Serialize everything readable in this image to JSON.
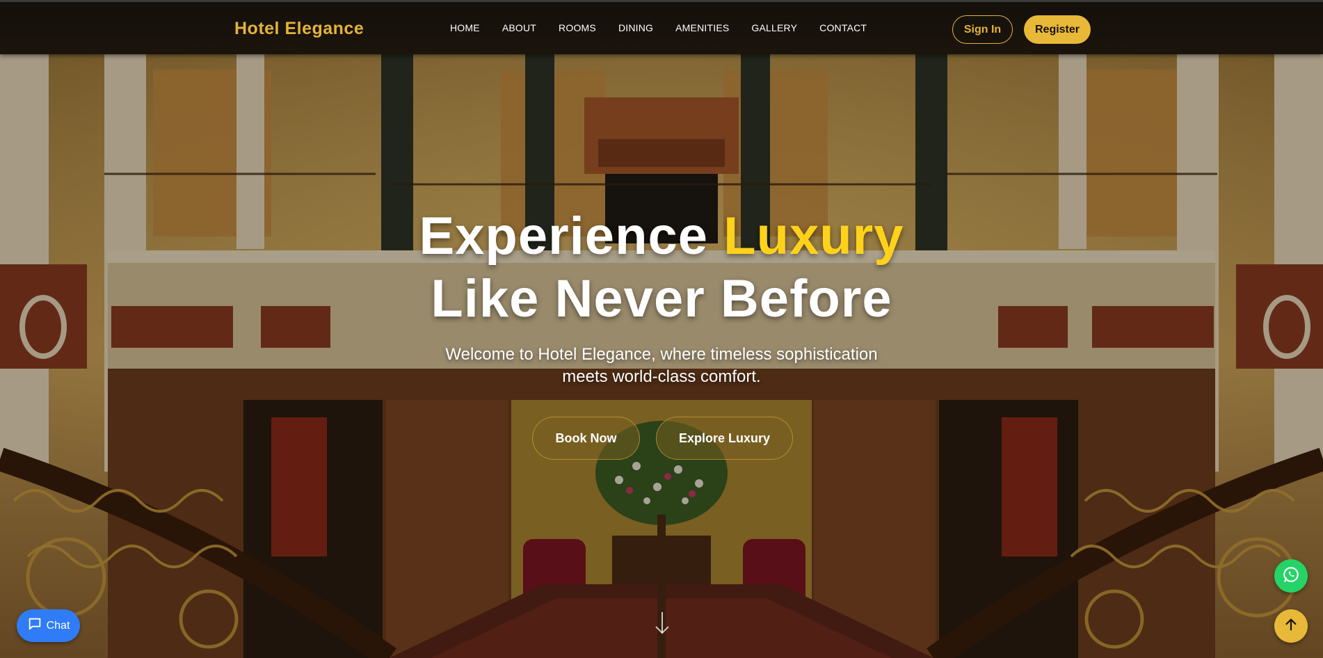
{
  "brand": {
    "name": "Hotel Elegance"
  },
  "nav": {
    "items": [
      {
        "label": "HOME"
      },
      {
        "label": "ABOUT"
      },
      {
        "label": "ROOMS"
      },
      {
        "label": "DINING"
      },
      {
        "label": "AMENITIES"
      },
      {
        "label": "GALLERY"
      },
      {
        "label": "CONTACT"
      }
    ],
    "sign_in": "Sign In",
    "register": "Register"
  },
  "hero": {
    "headline_part1": "Experience ",
    "headline_accent": "Luxury",
    "headline_line2": "Like Never Before",
    "subtitle": "Welcome to Hotel Elegance, where timeless sophistication meets world-class comfort.",
    "cta_primary": "Book Now",
    "cta_secondary": "Explore Luxury",
    "scroll_icon": "arrow-down-icon"
  },
  "widgets": {
    "chat_label": "Chat",
    "chat_icon": "chat-bubble-icon",
    "whatsapp_icon": "whatsapp-icon",
    "back_to_top_icon": "arrow-up-icon"
  },
  "colors": {
    "gold": "#e3b33a",
    "accent_yellow": "#ffd21a",
    "chat_blue": "#2f7cf6",
    "whatsapp_green": "#25d366"
  }
}
